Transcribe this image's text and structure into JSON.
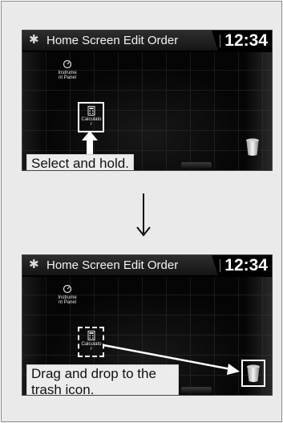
{
  "steps": [
    {
      "header": {
        "title": "Home Screen Edit Order",
        "clock": "12:34"
      },
      "apps": {
        "instrument_panel_label": "Instrume nt Panel",
        "calculator_label": "Calculato r"
      },
      "caption": "Select and hold."
    },
    {
      "header": {
        "title": "Home Screen Edit Order",
        "clock": "12:34"
      },
      "apps": {
        "instrument_panel_label": "Instrume nt Panel",
        "calculator_label": "Calculato r"
      },
      "caption": "Drag and drop to the trash icon."
    }
  ],
  "icons": {
    "settings": "gear-icon",
    "instrument_panel": "gauge-icon",
    "calculator": "calculator-icon",
    "trash": "trash-icon",
    "press": "up-arrow-icon",
    "transition": "down-arrow-icon",
    "drag": "drag-arrow-icon"
  },
  "colors": {
    "screen_bg": "#0b0b0b",
    "highlight": "#ffffff",
    "frame_bg": "#eaeaea"
  }
}
